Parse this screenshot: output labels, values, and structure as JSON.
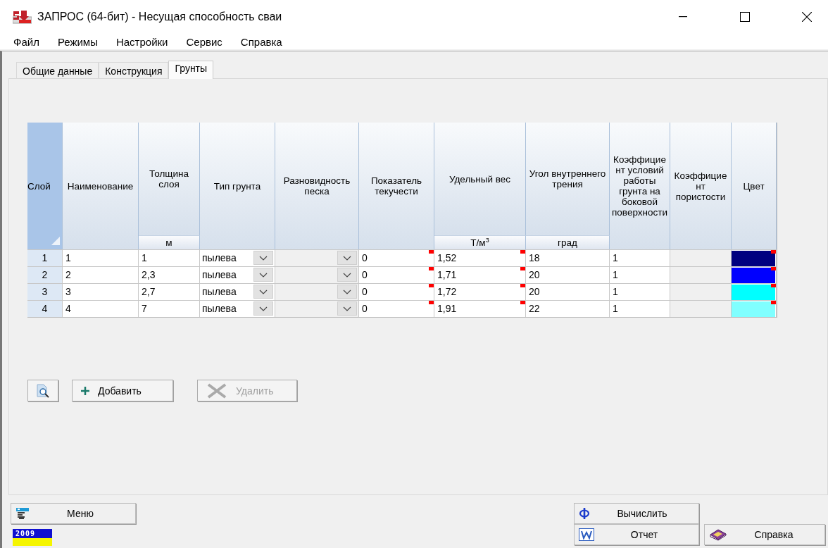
{
  "window": {
    "title": "ЗАПРОС (64-бит) - Несущая способность сваи"
  },
  "menu": [
    "Файл",
    "Режимы",
    "Настройки",
    "Сервис",
    "Справка"
  ],
  "tabs": [
    {
      "label": "Общие данные",
      "selected": false
    },
    {
      "label": "Конструкция",
      "selected": false
    },
    {
      "label": "Грунты",
      "selected": true
    }
  ],
  "table": {
    "columns": [
      {
        "kind": "rowheader",
        "title": "Слой"
      },
      {
        "kind": "text",
        "title": "Наименование"
      },
      {
        "kind": "text",
        "title": "Толщина слоя",
        "unit": "м"
      },
      {
        "kind": "combo",
        "title": "Тип грунта"
      },
      {
        "kind": "combo",
        "title": "Разновидность песка",
        "disabled": true
      },
      {
        "kind": "text",
        "title": "Показатель текучести",
        "marked": true
      },
      {
        "kind": "text",
        "title": "Удельный вес",
        "unit": "Т/м$^{3}$",
        "marked": true
      },
      {
        "kind": "text",
        "title": "Угол внутреннего трения",
        "unit": "град"
      },
      {
        "kind": "text",
        "title": "Коэффициент условий работы грунта на боковой поверхности"
      },
      {
        "kind": "text",
        "title": "Коэффициент пористости",
        "disabled": true
      },
      {
        "kind": "color",
        "title": "Цвет",
        "marked": true
      }
    ],
    "rows": [
      {
        "layer": "1",
        "name": "1",
        "thickness": "1",
        "soil_type": "пылева",
        "liquidity": "0",
        "weight": "1,52",
        "angle": "18",
        "coef": "1",
        "color": "#000080"
      },
      {
        "layer": "2",
        "name": "2",
        "thickness": "2,3",
        "soil_type": "пылева",
        "liquidity": "0",
        "weight": "1,71",
        "angle": "20",
        "coef": "1",
        "color": "#0000ff"
      },
      {
        "layer": "3",
        "name": "3",
        "thickness": "2,7",
        "soil_type": "пылева",
        "liquidity": "0",
        "weight": "1,72",
        "angle": "20",
        "coef": "1",
        "color": "#00ffff"
      },
      {
        "layer": "4",
        "name": "4",
        "thickness": "7",
        "soil_type": "пылева",
        "liquidity": "0",
        "weight": "1,91",
        "angle": "22",
        "coef": "1",
        "color": "#80ffff"
      }
    ]
  },
  "toolbar": [
    {
      "kind": "preview"
    },
    {
      "kind": "add",
      "label": "Добавить",
      "disabled": false
    },
    {
      "kind": "delete",
      "label": "Удалить",
      "disabled": true
    }
  ],
  "bottom": {
    "menu_button": "Меню",
    "year_badge": "2009",
    "calculate_button": "Вычислить",
    "report_button": "Отчет",
    "help_button": "Справка"
  }
}
